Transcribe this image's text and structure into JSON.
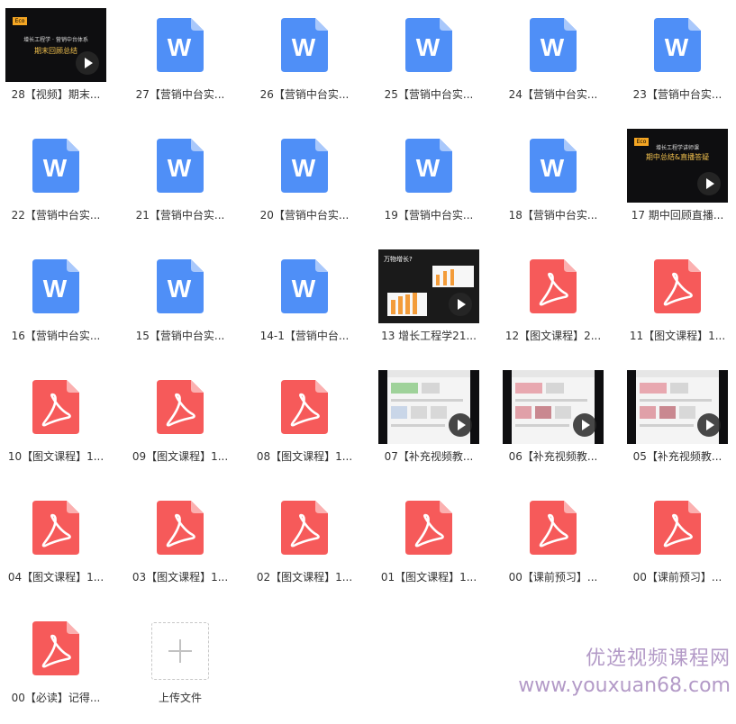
{
  "colors": {
    "word_blue": "#4f8ff7",
    "pdf_red": "#f65a5a",
    "label": "#333333",
    "watermark": "#9a79b5"
  },
  "files": [
    {
      "type": "video",
      "label": "28【视频】期末...",
      "thumb_text": [
        "Eco",
        "增长工程学 · 营销中台体系",
        "期末回顾总结"
      ]
    },
    {
      "type": "word",
      "label": "27【营销中台实..."
    },
    {
      "type": "word",
      "label": "26【营销中台实..."
    },
    {
      "type": "word",
      "label": "25【营销中台实..."
    },
    {
      "type": "word",
      "label": "24【营销中台实..."
    },
    {
      "type": "word",
      "label": "23【营销中台实..."
    },
    {
      "type": "word",
      "label": "22【营销中台实..."
    },
    {
      "type": "word",
      "label": "21【营销中台实..."
    },
    {
      "type": "word",
      "label": "20【营销中台实..."
    },
    {
      "type": "word",
      "label": "19【营销中台实..."
    },
    {
      "type": "word",
      "label": "18【营销中台实..."
    },
    {
      "type": "video",
      "label": "17 期中回顾直播...",
      "thumb_text": [
        "Eco",
        "增长工程学讲师课",
        "期中总结&直播答疑"
      ]
    },
    {
      "type": "word",
      "label": "16【营销中台实..."
    },
    {
      "type": "word",
      "label": "15【营销中台实..."
    },
    {
      "type": "word",
      "label": "14-1【营销中台..."
    },
    {
      "type": "video",
      "label": "13 增长工程学21...",
      "thumb_text": [
        "万物增长?"
      ]
    },
    {
      "type": "pdf",
      "label": "12【图文课程】2..."
    },
    {
      "type": "pdf",
      "label": "11【图文课程】1..."
    },
    {
      "type": "pdf",
      "label": "10【图文课程】1..."
    },
    {
      "type": "pdf",
      "label": "09【图文课程】1..."
    },
    {
      "type": "pdf",
      "label": "08【图文课程】1..."
    },
    {
      "type": "video",
      "label": "07【补充视频教...",
      "thumb_text": []
    },
    {
      "type": "video",
      "label": "06【补充视频教...",
      "thumb_text": []
    },
    {
      "type": "video",
      "label": "05【补充视频教...",
      "thumb_text": []
    },
    {
      "type": "pdf",
      "label": "04【图文课程】1..."
    },
    {
      "type": "pdf",
      "label": "03【图文课程】1..."
    },
    {
      "type": "pdf",
      "label": "02【图文课程】1..."
    },
    {
      "type": "pdf",
      "label": "01【图文课程】1..."
    },
    {
      "type": "pdf",
      "label": "00【课前预习】..."
    },
    {
      "type": "pdf",
      "label": "00【课前预习】..."
    },
    {
      "type": "pdf",
      "label": "00【必读】记得..."
    }
  ],
  "upload": {
    "label": "上传文件"
  },
  "watermark": {
    "line1": "优选视频课程网",
    "line2": "www.youxuan68.com"
  }
}
